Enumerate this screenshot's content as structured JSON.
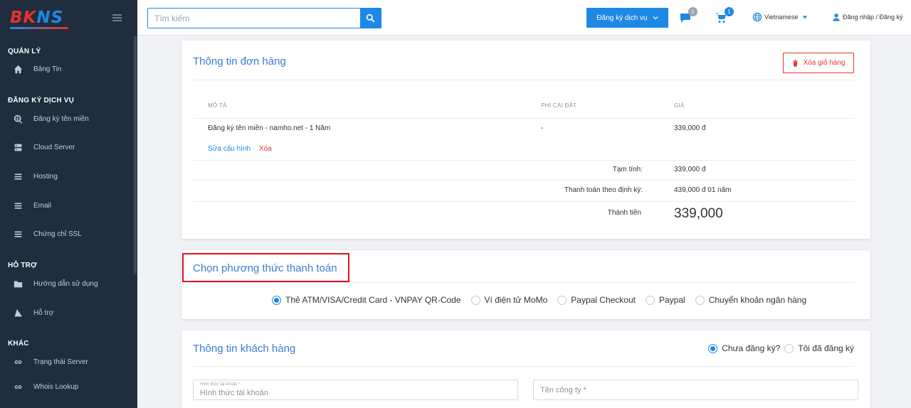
{
  "brand": {
    "logo_bk": "BK",
    "logo_ns": "NS"
  },
  "sidebar": {
    "sections": [
      {
        "title": "QUẢN LÝ",
        "items": [
          {
            "label": "Bảng Tin",
            "icon": "home-icon"
          }
        ]
      },
      {
        "title": "ĐĂNG KÝ DỊCH VỤ",
        "items": [
          {
            "label": "Đăng ký tên miền",
            "icon": "domain-icon"
          },
          {
            "label": "Cloud Server",
            "icon": "server-icon"
          },
          {
            "label": "Hosting",
            "icon": "list-icon"
          },
          {
            "label": "Email",
            "icon": "list-icon"
          },
          {
            "label": "Chứng chỉ SSL",
            "icon": "list-icon"
          }
        ]
      },
      {
        "title": "HỖ TRỢ",
        "items": [
          {
            "label": "Hướng dẫn sử dụng",
            "icon": "folder-icon"
          },
          {
            "label": "Hỗ trợ",
            "icon": "support-icon"
          }
        ]
      },
      {
        "title": "KHÁC",
        "items": [
          {
            "label": "Trạng thái Server",
            "icon": "link-icon"
          },
          {
            "label": "Whois Lookup",
            "icon": "link-icon"
          }
        ]
      }
    ]
  },
  "topbar": {
    "search_placeholder": "Tìm kiếm",
    "register_button": "Đăng ký dịch vụ",
    "messages_badge": "0",
    "cart_badge": "1",
    "language": "Vietnamese",
    "login": "Đăng nhập / Đăng ký"
  },
  "order": {
    "title": "Thông tin đơn hàng",
    "clear_button": "Xóa giỏ hàng",
    "columns": [
      "MÔ TẢ",
      "PHÍ CÀI ĐẶT",
      "GIÁ"
    ],
    "item": {
      "description": "Đăng ký tên miền - namho.net - 1 Năm",
      "setup_fee": "-",
      "price": "339,000 đ"
    },
    "edit_link": "Sửa cấu hình",
    "delete_link": "Xóa",
    "subtotal_label": "Tạm tính:",
    "subtotal_value": "339,000 đ",
    "recurring_label": "Thanh toán theo định kỳ:",
    "recurring_value": "439,000 đ 01 năm",
    "total_label": "Thành tiền",
    "total_value": "339,000"
  },
  "payment": {
    "title": "Chọn phương thức thanh toán",
    "options": [
      {
        "label": "Thẻ ATM/VISA/Credit Card - VNPAY QR-Code",
        "checked": true
      },
      {
        "label": "Ví điện tử MoMo",
        "checked": false
      },
      {
        "label": "Paypal Checkout",
        "checked": false
      },
      {
        "label": "Paypal",
        "checked": false
      },
      {
        "label": "Chuyển khoản ngân hàng",
        "checked": false
      }
    ]
  },
  "customer": {
    "title": "Thông tin khách hàng",
    "options": [
      {
        "label": "Chưa đăng ký?",
        "checked": true
      },
      {
        "label": "Tôi đã đăng ký",
        "checked": false
      }
    ],
    "account_type_label": "Hình thức tài khoản *",
    "account_type_placeholder": "Hình thức tài khoản",
    "company_placeholder": "Tên công ty *"
  },
  "colors": {
    "sidebar_bg": "#1f2d3d",
    "primary": "#1e88e5",
    "danger": "#e53935",
    "highlight": "#e0121b",
    "badge_grey": "#9aa3ad"
  }
}
